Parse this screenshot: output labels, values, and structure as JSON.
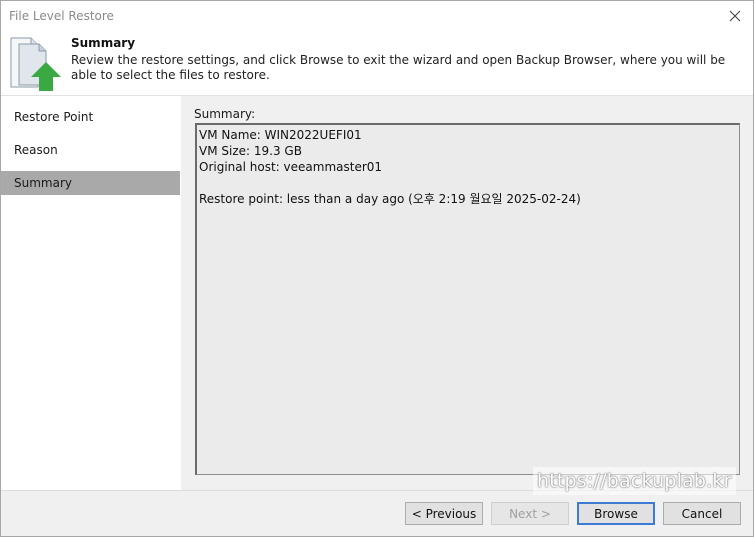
{
  "window": {
    "title": "File Level Restore"
  },
  "header": {
    "icon": "file-restore-arrow-icon",
    "title": "Summary",
    "description": "Review the restore settings, and click Browse to exit the wizard and open Backup Browser, where you will be able to select the files to restore."
  },
  "sidebar": {
    "steps": [
      {
        "label": "Restore Point",
        "active": false
      },
      {
        "label": "Reason",
        "active": false
      },
      {
        "label": "Summary",
        "active": true
      }
    ]
  },
  "summary": {
    "label": "Summary:",
    "lines": [
      "VM Name: WIN2022UEFI01",
      "VM Size: 19.3 GB",
      "Original host: veeammaster01",
      "",
      "Restore point: less than a day ago (오후 2:19 월요일 2025-02-24)"
    ]
  },
  "buttons": {
    "previous": "< Previous",
    "next": "Next >",
    "browse": "Browse",
    "cancel": "Cancel"
  },
  "watermark": "https://backuplab.kr",
  "colors": {
    "active_step": "#a9a9a9",
    "arrow_green": "#3aa843",
    "default_button_border": "#3d7bd2"
  }
}
